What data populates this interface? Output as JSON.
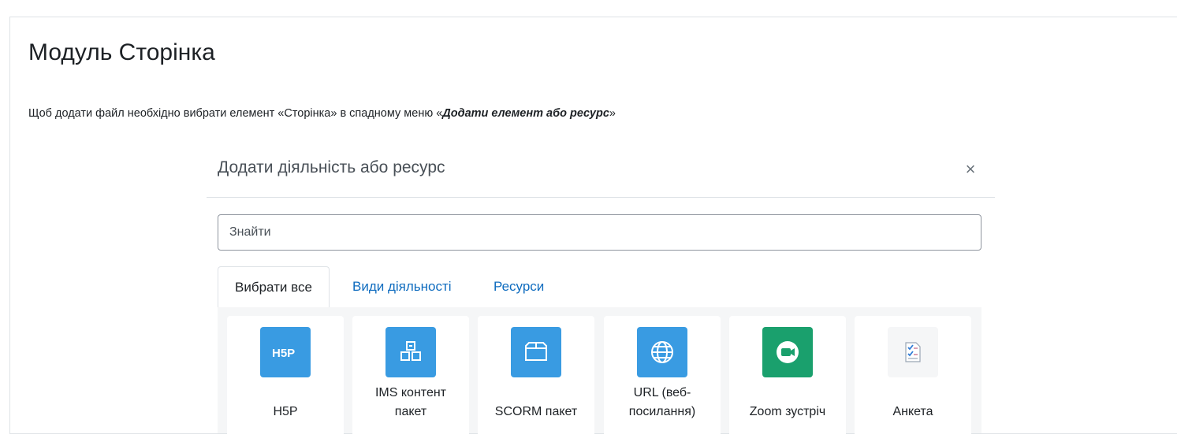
{
  "page": {
    "title": "Модуль Сторінка",
    "intro_prefix": "Щоб додати файл необхідно вибрати елемент «Сторінка» в спадному меню «",
    "intro_emph": "Додати елемент або ресурс",
    "intro_suffix": "»"
  },
  "modal": {
    "title": "Додати діяльність або ресурс",
    "close_glyph": "×",
    "search_placeholder": "Знайти",
    "tabs": [
      {
        "label": "Вибрати все",
        "active": true
      },
      {
        "label": "Види діяльності",
        "active": false
      },
      {
        "label": "Ресурси",
        "active": false
      }
    ],
    "items": [
      {
        "name": "H5P",
        "lines": [
          "",
          "H5P"
        ],
        "icon": "h5p-icon",
        "color": "#399be2"
      },
      {
        "name": "IMS контент пакет",
        "lines": [
          "IMS контент",
          "пакет"
        ],
        "icon": "boxes-icon",
        "color": "#399be2"
      },
      {
        "name": "SCORM пакет",
        "lines": [
          "",
          "SCORM пакет"
        ],
        "icon": "box-icon",
        "color": "#399be2"
      },
      {
        "name": "URL (веб-посилання)",
        "lines": [
          "URL (веб-",
          "посилання)"
        ],
        "icon": "globe-icon",
        "color": "#399be2"
      },
      {
        "name": "Zoom зустріч",
        "lines": [
          "",
          "Zoom зустріч"
        ],
        "icon": "video-camera-icon",
        "color": "#1aa06d"
      },
      {
        "name": "Анкета",
        "lines": [
          "",
          "Анкета"
        ],
        "icon": "questionnaire-icon",
        "color": "#f5f6f7"
      }
    ]
  }
}
